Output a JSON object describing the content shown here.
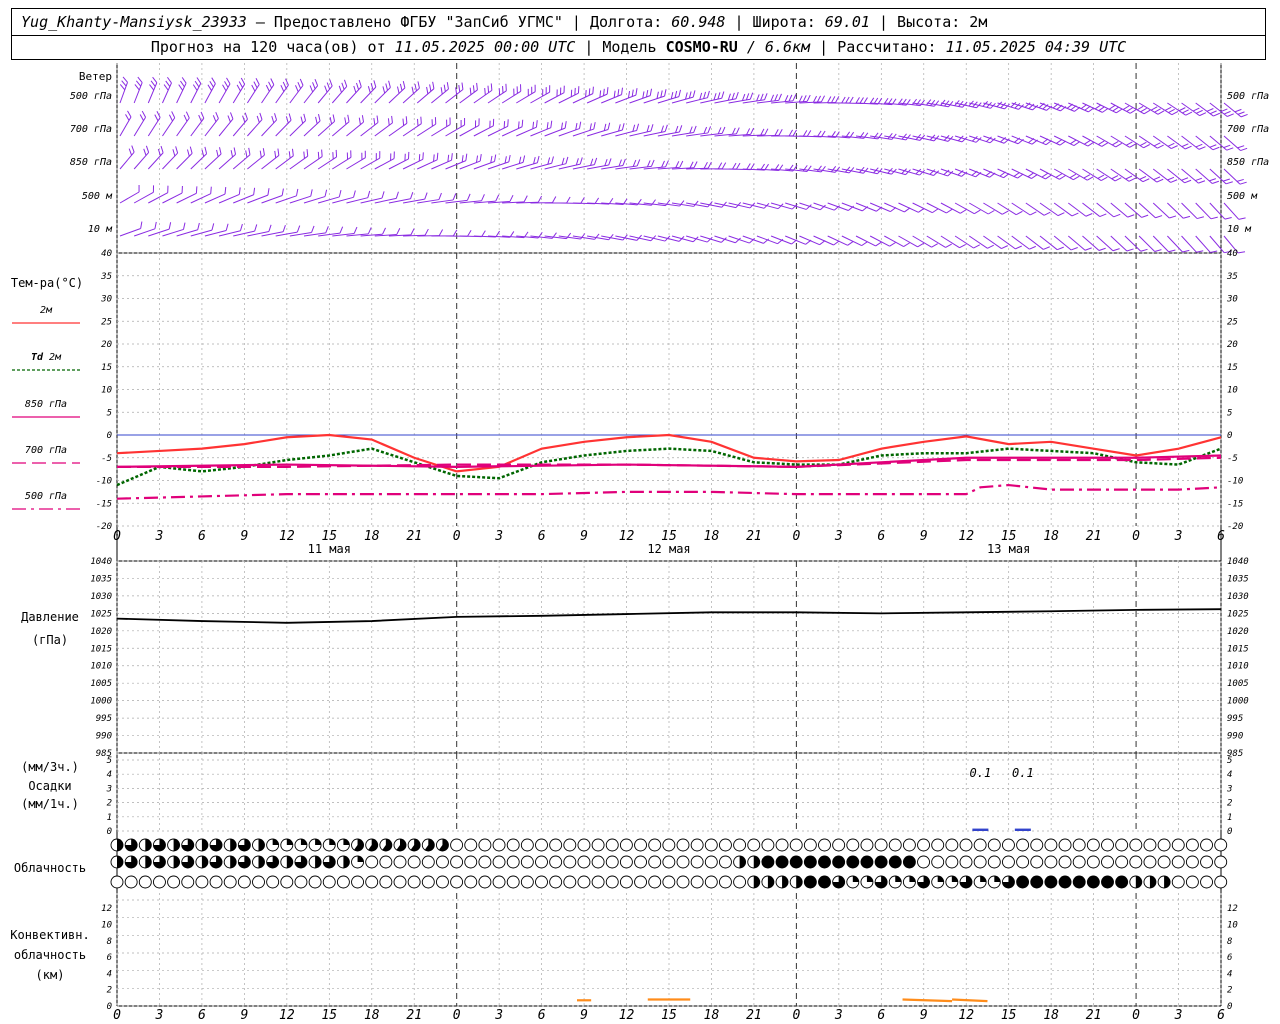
{
  "header": {
    "station": "Yug_Khanty-Mansiysk_23933",
    "dash": "—",
    "provided_by": "Предоставлено ФГБУ \"ЗапСиб УГМС\"",
    "sep": "|",
    "lon_label": "Долгота:",
    "lon_value": "60.948",
    "lat_label": "Широта:",
    "lat_value": "69.01",
    "alt_label": "Высота:",
    "alt_value": "2м",
    "forecast_prefix": "Прогноз на 120 часа(ов) от",
    "forecast_time": "11.05.2025 00:00 UTC",
    "model_label": "Модель",
    "model_name": "COSMO-RU",
    "model_res": "/ 6.6км",
    "computed_label": "Рассчитано:",
    "computed_time": "11.05.2025 04:39 UTC"
  },
  "wind_panel": {
    "title": "Ветер",
    "levels": [
      "500 гПа",
      "700 гПа",
      "850 гПа",
      "500 м",
      "10  м"
    ]
  },
  "x_axis": {
    "hour_labels": [
      "0",
      "3",
      "6",
      "9",
      "12",
      "15",
      "18",
      "21",
      "0",
      "3",
      "6",
      "9",
      "12",
      "15",
      "18",
      "21",
      "0",
      "3",
      "6",
      "9",
      "12",
      "15",
      "18",
      "21",
      "0",
      "3",
      "6"
    ],
    "day_labels": [
      {
        "hour": 15,
        "text": "11 мая"
      },
      {
        "hour": 39,
        "text": "12 мая"
      },
      {
        "hour": 63,
        "text": "13 мая"
      }
    ],
    "day_boundaries_hours": [
      24,
      48,
      72,
      96
    ]
  },
  "temperature_panel": {
    "title": "Тем-ра(°C)",
    "legend": [
      {
        "label": "2м",
        "color": "#ff3333",
        "dash": "solid"
      },
      {
        "label": "Td 2м",
        "label_prefix": "Td",
        "label_suffix": "2м",
        "color": "#006600",
        "dash": "dot"
      },
      {
        "label": "850 гПа",
        "color": "#e0007a",
        "dash": "solid"
      },
      {
        "label": "700 гПа",
        "color": "#e0007a",
        "dash": "dash"
      },
      {
        "label": "500 гПа",
        "color": "#e0007a",
        "dash": "dashdot"
      }
    ],
    "y_ticks": [
      "40",
      "35",
      "30",
      "25",
      "20",
      "15",
      "10",
      "5",
      "0",
      "-5",
      "-10",
      "-15",
      "-20"
    ]
  },
  "pressure_panel": {
    "title": "Давление",
    "unit": "(гПа)",
    "y_ticks": [
      "1040",
      "1035",
      "1030",
      "1025",
      "1020",
      "1015",
      "1010",
      "1005",
      "1000",
      "995",
      "990",
      "985"
    ]
  },
  "precip_panel": {
    "unit_3h": "(мм/3ч.)",
    "title": "Осадки",
    "unit_1h": "(мм/1ч.)",
    "y_ticks": [
      "5",
      "4",
      "3",
      "2",
      "1",
      "0"
    ],
    "labels": [
      {
        "hour": 61,
        "text": "0.1"
      },
      {
        "hour": 64,
        "text": "0.1"
      }
    ]
  },
  "cloud_panel": {
    "title": "Облачность"
  },
  "convective_panel": {
    "title_line1": "Конвективн.",
    "title_line2": "облачность",
    "unit": "(км)",
    "y_ticks": [
      "12",
      "10",
      "8",
      "6",
      "4",
      "2",
      "0"
    ]
  },
  "chart_data": {
    "type": "line",
    "x_unit": "hours since 11.05.2025 00:00 UTC",
    "x_range": [
      0,
      78
    ],
    "temperature": {
      "ylim": [
        -20,
        40
      ],
      "series": [
        {
          "name": "2м",
          "color": "#ff3333",
          "x": [
            0,
            3,
            6,
            9,
            12,
            15,
            18,
            21,
            24,
            27,
            30,
            33,
            36,
            39,
            42,
            45,
            48,
            51,
            54,
            57,
            60,
            63,
            66,
            69,
            72,
            75,
            78
          ],
          "y": [
            -4,
            -3.5,
            -3,
            -2,
            -0.5,
            0,
            -1,
            -5,
            -8,
            -7,
            -3,
            -1.5,
            -0.5,
            0,
            -1.5,
            -5,
            -5.8,
            -5.5,
            -3,
            -1.5,
            -0.3,
            -2,
            -1.5,
            -3,
            -4.5,
            -3,
            -0.5
          ]
        },
        {
          "name": "Td 2м",
          "color": "#006600",
          "x": [
            0,
            3,
            6,
            9,
            12,
            15,
            18,
            21,
            24,
            27,
            30,
            33,
            36,
            39,
            42,
            45,
            48,
            51,
            54,
            57,
            60,
            63,
            66,
            69,
            72,
            75,
            78
          ],
          "y": [
            -11,
            -7,
            -8,
            -7,
            -5.5,
            -4.5,
            -3,
            -6,
            -9,
            -9.5,
            -6,
            -4.5,
            -3.5,
            -3,
            -3.5,
            -6,
            -6.5,
            -6.5,
            -4.5,
            -4,
            -4,
            -3,
            -3.5,
            -4,
            -6,
            -6.5,
            -3
          ]
        },
        {
          "name": "850 гПа",
          "color": "#e0007a",
          "x": [
            0,
            12,
            24,
            36,
            48,
            60,
            72,
            78
          ],
          "y": [
            -7,
            -6.5,
            -7,
            -6.5,
            -7,
            -5,
            -5,
            -4.5
          ]
        },
        {
          "name": "700 гПа",
          "color": "#e0007a",
          "x": [
            0,
            12,
            24,
            36,
            48,
            60,
            72,
            78
          ],
          "y": [
            -7,
            -7,
            -6.5,
            -6.5,
            -7,
            -5.5,
            -5.5,
            -5
          ]
        },
        {
          "name": "500 гПа",
          "color": "#e0007a",
          "x": [
            0,
            6,
            12,
            18,
            24,
            30,
            36,
            42,
            48,
            54,
            60,
            61,
            63,
            66,
            72,
            75,
            78
          ],
          "y": [
            -14,
            -13.5,
            -13,
            -13,
            -13,
            -13,
            -12.5,
            -12.5,
            -13,
            -13,
            -13,
            -11.5,
            -11,
            -12,
            -12,
            -12,
            -11.5
          ]
        }
      ]
    },
    "pressure": {
      "ylim": [
        985,
        1040
      ],
      "series": [
        {
          "name": "Давление",
          "color": "#000000",
          "x": [
            0,
            6,
            12,
            18,
            24,
            30,
            36,
            42,
            48,
            54,
            60,
            66,
            72,
            78
          ],
          "y": [
            1023.5,
            1022.8,
            1022.3,
            1022.8,
            1024,
            1024.3,
            1024.8,
            1025.3,
            1025.3,
            1025,
            1025.3,
            1025.6,
            1026,
            1026.2
          ]
        }
      ]
    },
    "precipitation": {
      "ylim": [
        0,
        5
      ],
      "x": [
        61,
        64
      ],
      "values": [
        0.1,
        0.1
      ]
    },
    "convective_cloud": {
      "ylim": [
        0,
        13
      ],
      "segments": [
        {
          "x": [
            32.5,
            33.5
          ],
          "y": [
            0.7,
            0.7
          ]
        },
        {
          "x": [
            37.5,
            40.5
          ],
          "y": [
            0.8,
            0.8
          ]
        },
        {
          "x": [
            55.5,
            59
          ],
          "y": [
            0.8,
            0.6
          ]
        },
        {
          "x": [
            59,
            61.5
          ],
          "y": [
            0.8,
            0.6
          ]
        }
      ]
    }
  }
}
